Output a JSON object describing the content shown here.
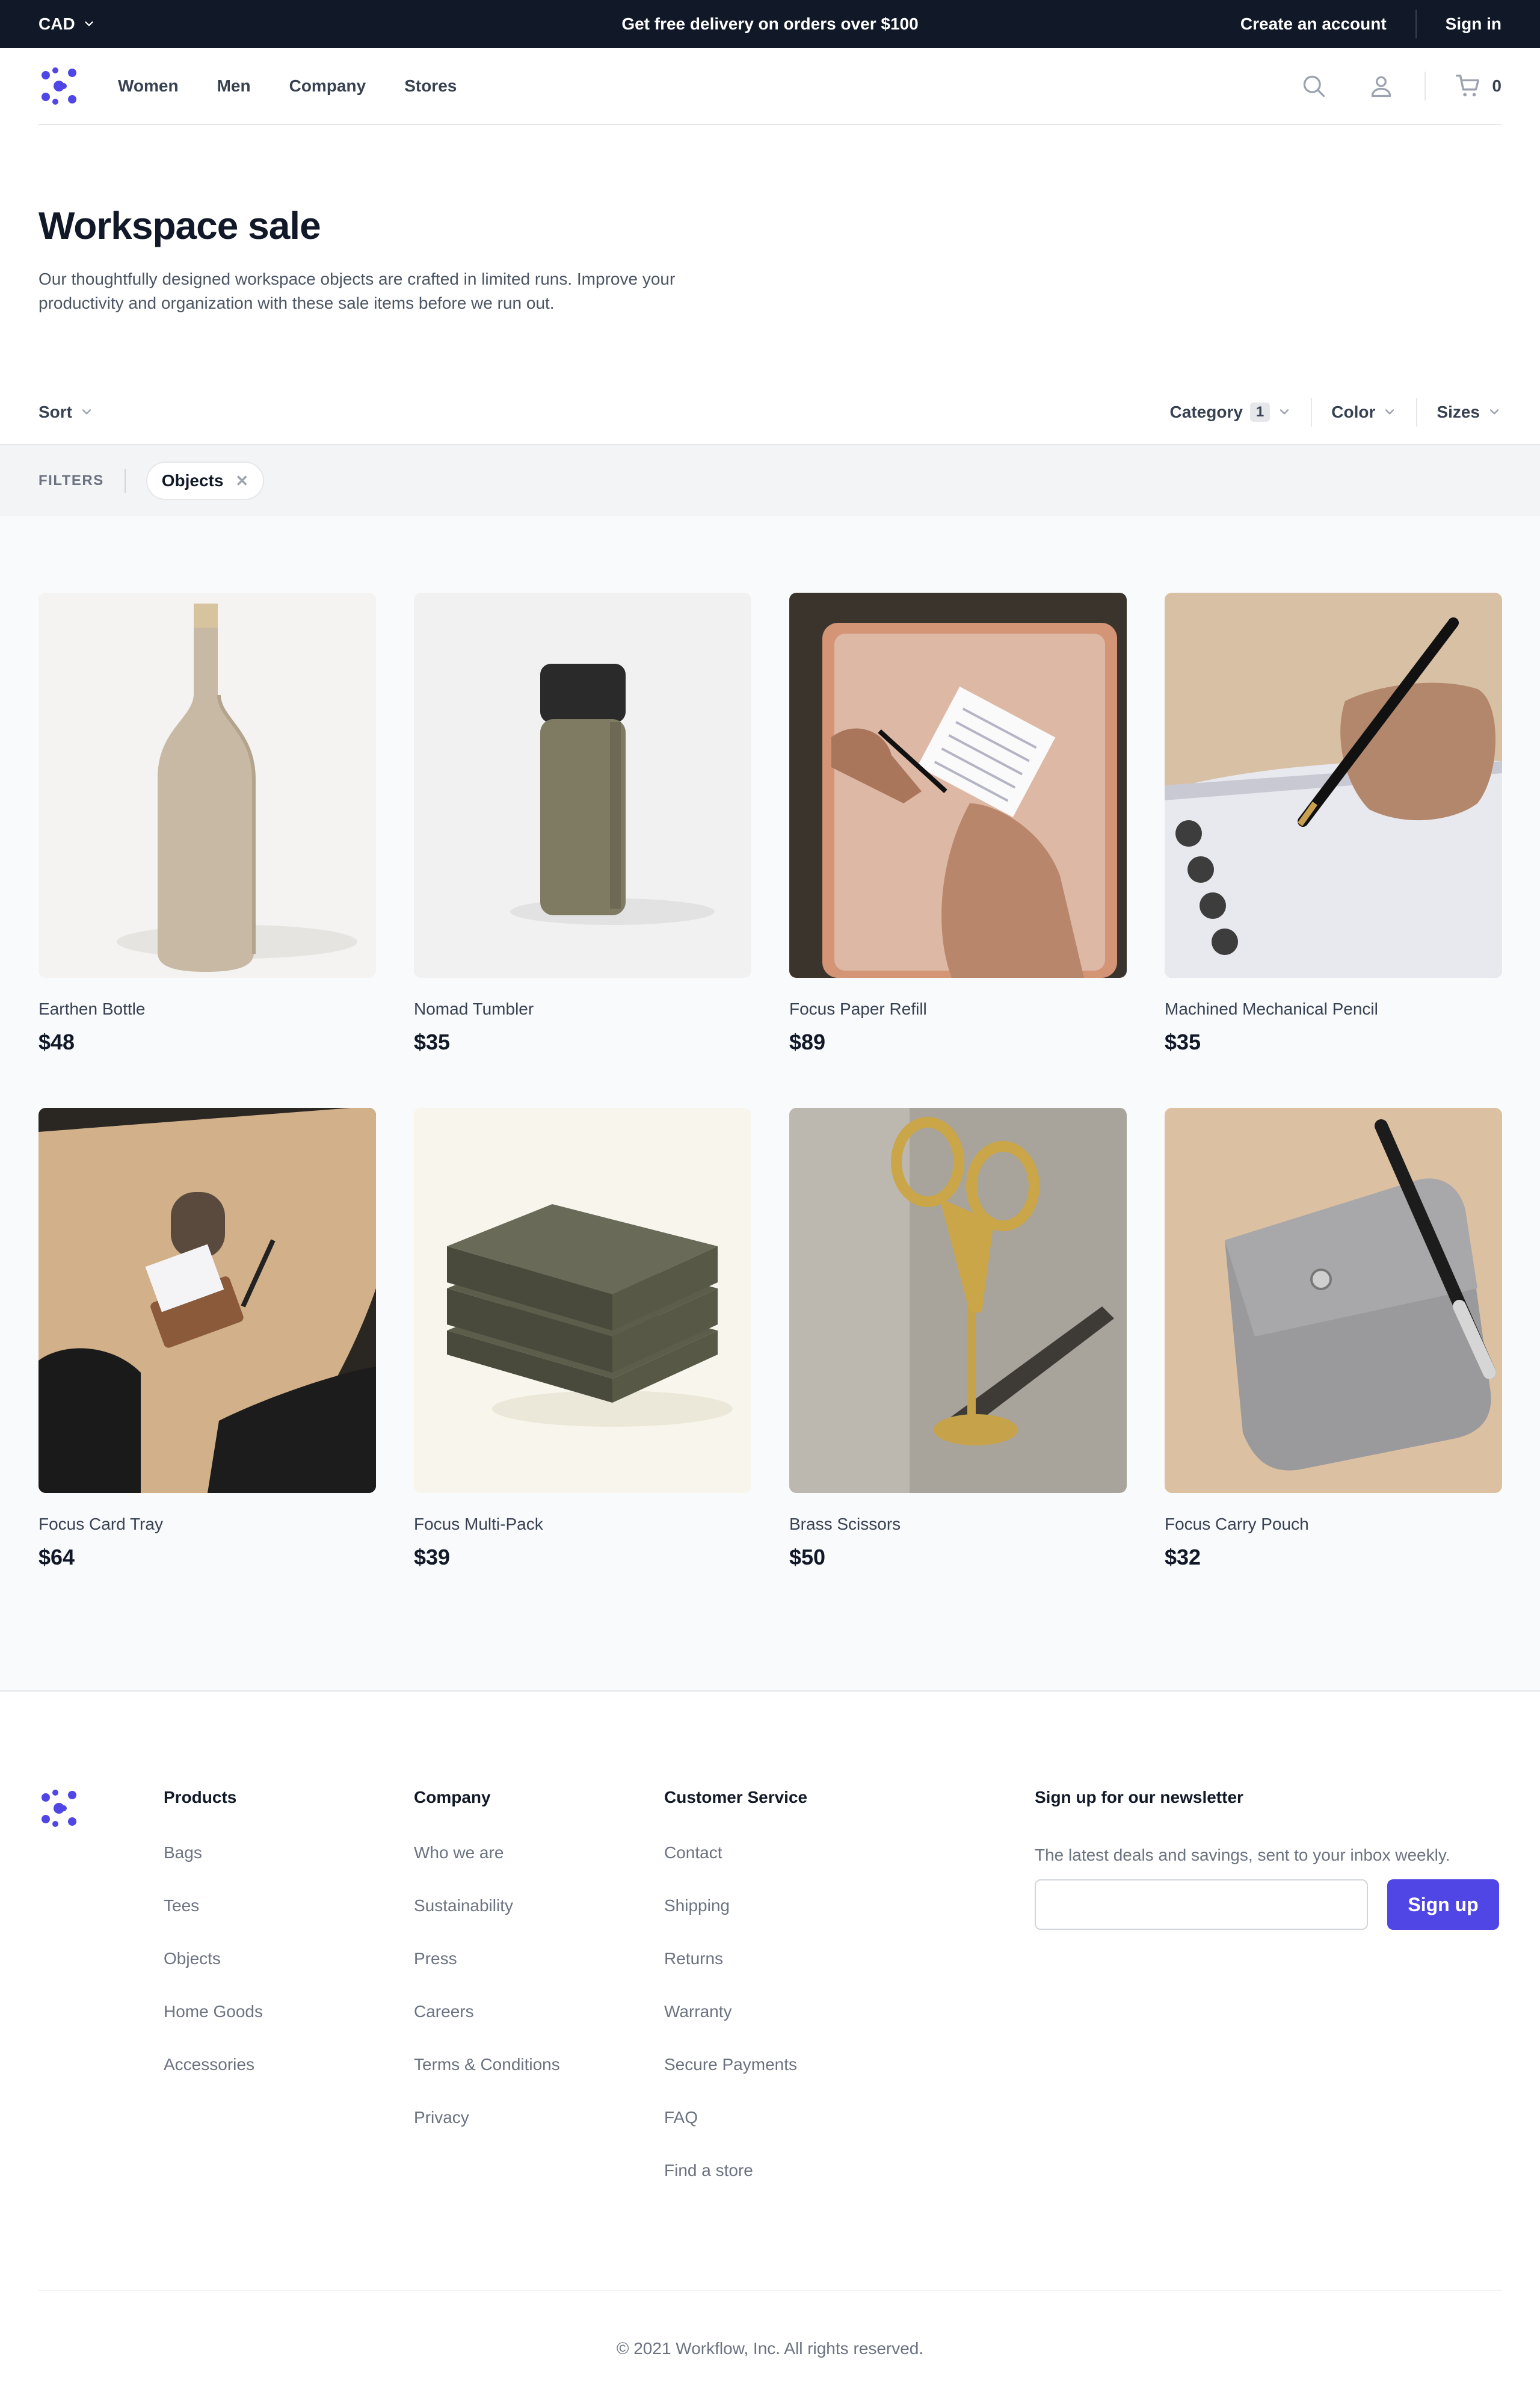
{
  "topbar": {
    "currency": "CAD",
    "promo": "Get free delivery on orders over $100",
    "create_account": "Create an account",
    "sign_in": "Sign in"
  },
  "nav": {
    "items": [
      "Women",
      "Men",
      "Company",
      "Stores"
    ],
    "cart_count": "0"
  },
  "hero": {
    "title": "Workspace sale",
    "description": "Our thoughtfully designed workspace objects are crafted in limited runs. Improve your productivity and organization with these sale items before we run out."
  },
  "filters": {
    "sort_label": "Sort",
    "category_label": "Category",
    "category_count": "1",
    "color_label": "Color",
    "sizes_label": "Sizes",
    "active_label": "FILTERS",
    "active_filter": "Objects"
  },
  "products": [
    {
      "name": "Earthen Bottle",
      "price": "$48"
    },
    {
      "name": "Nomad Tumbler",
      "price": "$35"
    },
    {
      "name": "Focus Paper Refill",
      "price": "$89"
    },
    {
      "name": "Machined Mechanical Pencil",
      "price": "$35"
    },
    {
      "name": "Focus Card Tray",
      "price": "$64"
    },
    {
      "name": "Focus Multi-Pack",
      "price": "$39"
    },
    {
      "name": "Brass Scissors",
      "price": "$50"
    },
    {
      "name": "Focus Carry Pouch",
      "price": "$32"
    }
  ],
  "footer": {
    "products": {
      "title": "Products",
      "links": [
        "Bags",
        "Tees",
        "Objects",
        "Home Goods",
        "Accessories"
      ]
    },
    "company": {
      "title": "Company",
      "links": [
        "Who we are",
        "Sustainability",
        "Press",
        "Careers",
        "Terms & Conditions",
        "Privacy"
      ]
    },
    "customer_service": {
      "title": "Customer Service",
      "links": [
        "Contact",
        "Shipping",
        "Returns",
        "Warranty",
        "Secure Payments",
        "FAQ",
        "Find a store"
      ]
    },
    "newsletter": {
      "title": "Sign up for our newsletter",
      "description": "The latest deals and savings, sent to your inbox weekly.",
      "email_value": "",
      "button": "Sign up"
    },
    "copyright": "© 2021 Workflow, Inc. All rights reserved."
  },
  "colors": {
    "accent": "#4f46e5",
    "topbar_bg": "#111827"
  }
}
